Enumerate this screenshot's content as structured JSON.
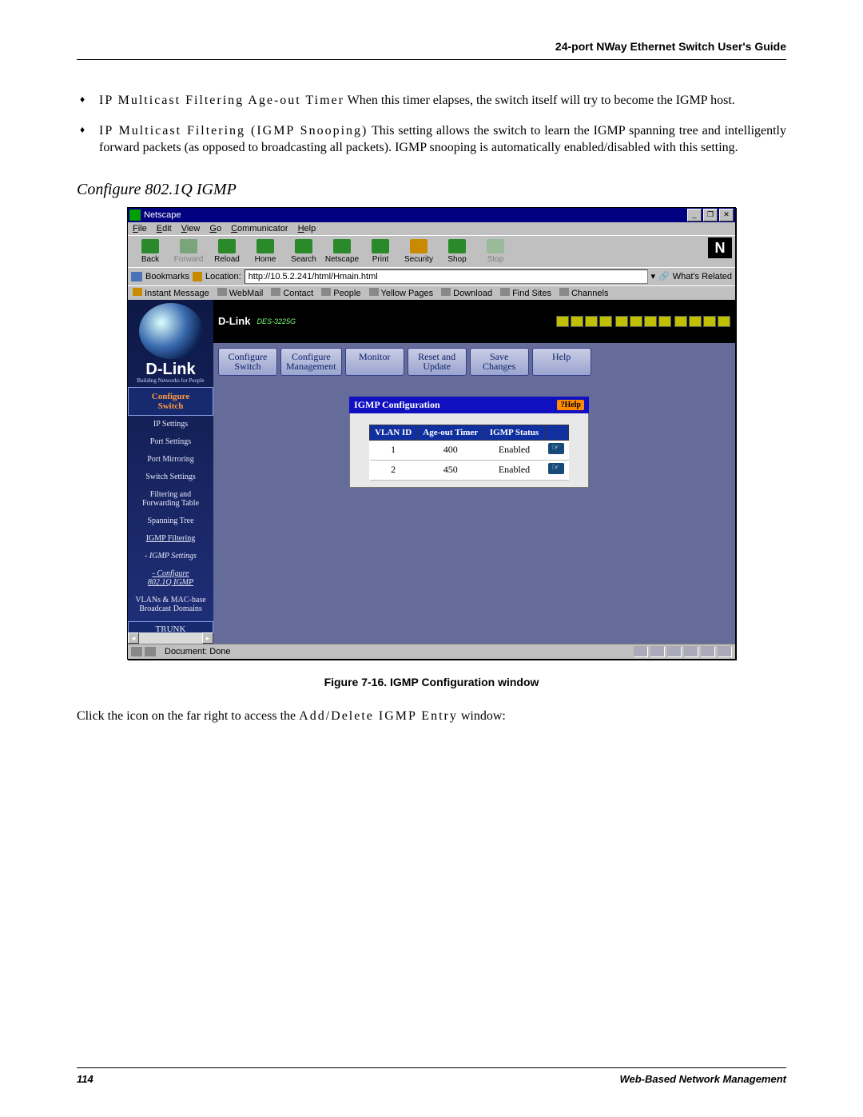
{
  "header": {
    "title": "24-port NWay Ethernet Switch User's Guide"
  },
  "bullets": [
    {
      "term": "IP Multicast Filtering Age-out Timer",
      "text": " When this timer elapses, the switch itself will try to become the IGMP host."
    },
    {
      "term": "IP Multicast Filtering (IGMP Snooping)",
      "text": " This setting allows the switch to learn the IGMP spanning tree and intelligently forward packets (as opposed to broadcasting all packets). IGMP snooping is automatically enabled/disabled with this setting."
    }
  ],
  "section_title": "Configure 802.1Q IGMP",
  "browser": {
    "titlebar": "Netscape",
    "menus": [
      "File",
      "Edit",
      "View",
      "Go",
      "Communicator",
      "Help"
    ],
    "tools": [
      {
        "label": "Back",
        "cls": "ti-back"
      },
      {
        "label": "Forward",
        "cls": "ti-fwd",
        "disabled": true
      },
      {
        "label": "Reload",
        "cls": "ti-reload"
      },
      {
        "label": "Home",
        "cls": "ti-home"
      },
      {
        "label": "Search",
        "cls": "ti-search"
      },
      {
        "label": "Netscape",
        "cls": "ti-netscape"
      },
      {
        "label": "Print",
        "cls": "ti-print"
      },
      {
        "label": "Security",
        "cls": "ti-security"
      },
      {
        "label": "Shop",
        "cls": "ti-shop"
      },
      {
        "label": "Stop",
        "cls": "ti-stop",
        "disabled": true
      }
    ],
    "bookmarks_label": "Bookmarks",
    "location_label": "Location:",
    "location_value": "http://10.5.2.241/html/Hmain.html",
    "related_label": "What's Related",
    "quicklinks": [
      "Instant Message",
      "WebMail",
      "Contact",
      "People",
      "Yellow Pages",
      "Download",
      "Find Sites",
      "Channels"
    ],
    "status": "Document: Done"
  },
  "sidebar": {
    "logo": "D-Link",
    "tagline": "Building Networks for People",
    "head": "Configure\nSwitch",
    "items": [
      {
        "label": "IP Settings"
      },
      {
        "label": "Port Settings"
      },
      {
        "label": "Port Mirroring"
      },
      {
        "label": "Switch Settings"
      },
      {
        "label": "Filtering and\nForwarding Table"
      },
      {
        "label": "Spanning Tree"
      },
      {
        "label": "IGMP Filtering",
        "underline": true
      },
      {
        "label": "IGMP Settings",
        "dash": true,
        "italic": true
      },
      {
        "label": "Configure\n802.1Q IGMP",
        "dash": true,
        "italic": true,
        "underline": true
      },
      {
        "label": "VLANs & MAC-base\nBroadcast Domains"
      }
    ],
    "trunk": "TRUNK"
  },
  "device_label": "D-Link",
  "device_model": "DES-3225G",
  "nav_buttons": [
    "Configure\nSwitch",
    "Configure\nManagement",
    "Monitor",
    "Reset and\nUpdate",
    "Save\nChanges",
    "Help"
  ],
  "panel": {
    "title": "IGMP Configuration",
    "help": "Help",
    "columns": [
      "VLAN ID",
      "Age-out Timer",
      "IGMP Status",
      ""
    ],
    "rows": [
      {
        "vlan": "1",
        "age": "400",
        "status": "Enabled"
      },
      {
        "vlan": "2",
        "age": "450",
        "status": "Enabled"
      }
    ]
  },
  "caption": "Figure 7-16.  IGMP Configuration window",
  "body_after": {
    "pre": "Click the icon on the far right to access the ",
    "term": "Add/Delete IGMP Entry",
    "post": " window:"
  },
  "footer": {
    "page": "114",
    "section": "Web-Based Network Management"
  }
}
